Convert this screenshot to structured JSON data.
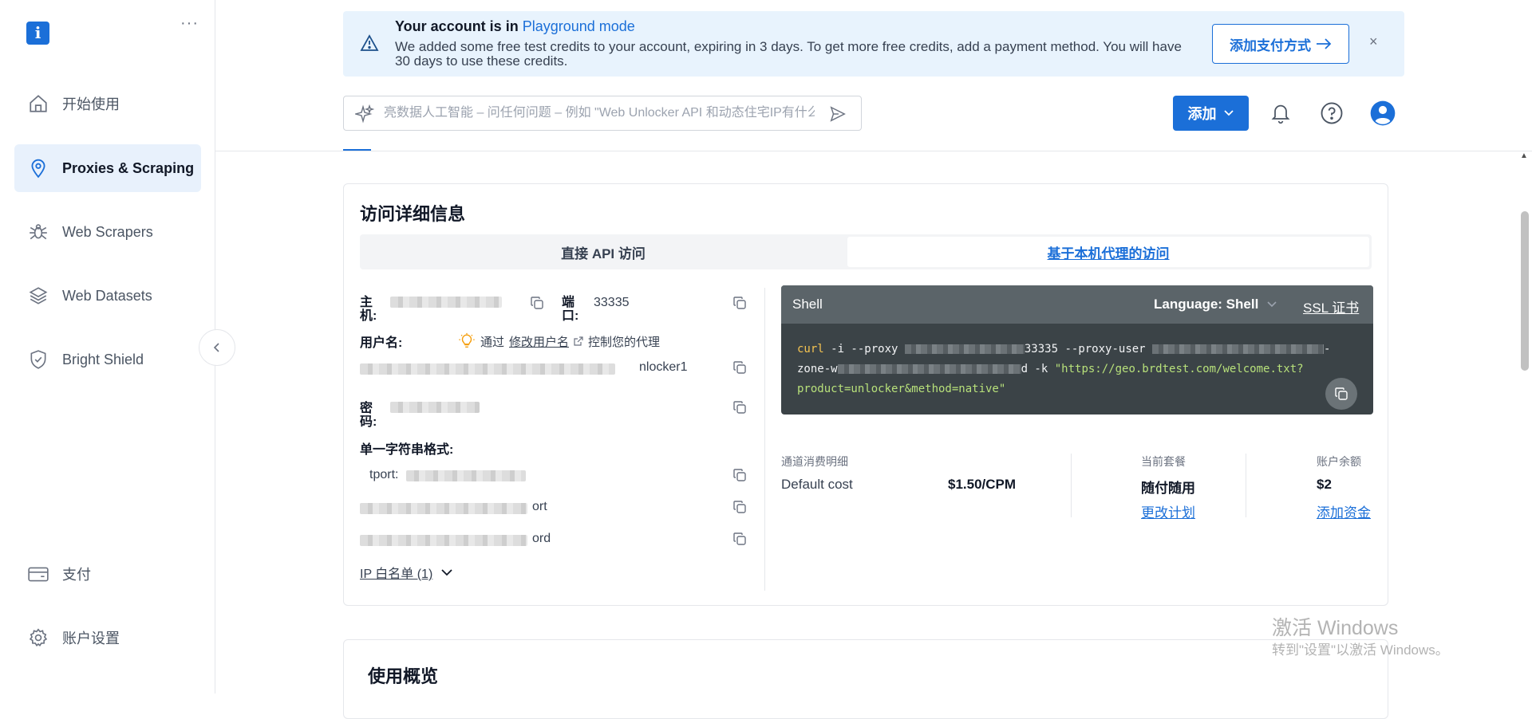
{
  "sidebar": {
    "logo_text": "i",
    "more_label": "···",
    "items": [
      {
        "label": "开始使用",
        "icon": "home-icon"
      },
      {
        "label": "Proxies & Scraping",
        "icon": "location-pin-icon",
        "active": true
      },
      {
        "label": "Web Scrapers",
        "icon": "spider-icon"
      },
      {
        "label": "Web Datasets",
        "icon": "stack-icon"
      },
      {
        "label": "Bright Shield",
        "icon": "shield-check-icon"
      }
    ],
    "bottom_items": [
      {
        "label": "支付",
        "icon": "card-icon"
      },
      {
        "label": "账户设置",
        "icon": "gear-icon"
      }
    ]
  },
  "banner": {
    "title_prefix": "Your account is in ",
    "title_link": "Playground mode",
    "text": "We added some free test credits to your account, expiring in 3 days. To get more free credits, add a payment method. You will have 30 days to use these credits.",
    "button_label": "添加支付方式",
    "close_label": "×"
  },
  "search": {
    "placeholder": "亮数据人工智能 – 问任何问题 – 例如 \"Web Unlocker API 和动态住宅IP有什么区别?\""
  },
  "header": {
    "add_button_label": "添加"
  },
  "access_card": {
    "title": "访问详细信息",
    "tab_direct": "直接 API 访问",
    "tab_proxy": "基于本机代理的访问",
    "host_label": "主机:",
    "port_label": "端口:",
    "port_value": "33335",
    "username_label": "用户名:",
    "hint_prefix": "通过",
    "hint_link": "修改用户名",
    "hint_suffix": "控制您的代理",
    "username_tail": "nlocker1",
    "password_label": "密码:",
    "single_string_label": "单一字符串格式:",
    "single_string_1_tail": "tport:",
    "single_string_2_tail": "ort",
    "single_string_3_tail": "ord",
    "ip_whitelist_label": "IP 白名单 (1)"
  },
  "shell": {
    "title": "Shell",
    "language_label": "Language: Shell",
    "ssl_label": "SSL 证书",
    "code_cmd": "curl",
    "code_line1_a": " -i --proxy ",
    "code_line1_port": "33335",
    "code_line1_b": " --proxy-user ",
    "code_line1_c": "-",
    "code_line2_a": "zone-w",
    "code_line2_b": "d -k ",
    "code_url_1": "\"https://geo.brdtest.com/welcome.txt?",
    "code_url_2": "product=unlocker&method=native\""
  },
  "billing": {
    "channel_label": "通道消费明细",
    "cost_name": "Default cost",
    "cost_value": "$1.50/CPM",
    "plan_label": "当前套餐",
    "plan_value": "随付随用",
    "plan_link": "更改计划",
    "balance_label": "账户余额",
    "balance_value": "$2",
    "balance_link": "添加资金"
  },
  "usage_card": {
    "title": "使用概览"
  },
  "watermark": {
    "line1": "激活 Windows",
    "line2": "转到\"设置\"以激活 Windows。"
  },
  "colors": {
    "accent": "#1b6fd8",
    "banner_bg": "#e8f3fd",
    "shell_bg": "#3b4347"
  }
}
